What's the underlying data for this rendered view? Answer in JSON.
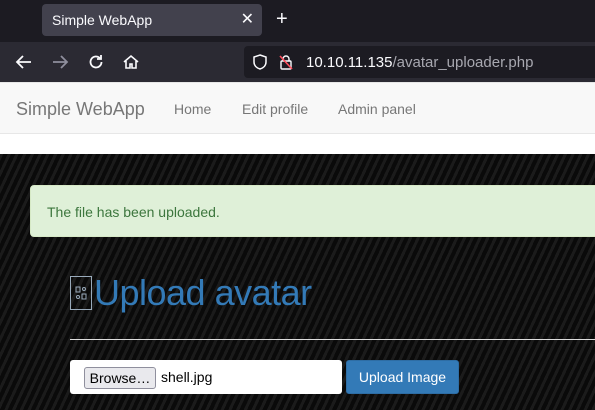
{
  "browser": {
    "tab_title": "Simple WebApp",
    "tab_close": "✕",
    "new_tab": "+",
    "url_host": "10.10.11.135",
    "url_path": "/avatar_uploader.php"
  },
  "site": {
    "brand": "Simple WebApp",
    "nav": [
      "Home",
      "Edit profile",
      "Admin panel"
    ]
  },
  "alert": {
    "message": "The file has been uploaded."
  },
  "upload": {
    "heading": "Upload avatar",
    "browse_label": "Browse…",
    "file_name": "shell.jpg",
    "submit_label": "Upload Image"
  },
  "colors": {
    "link_blue": "#337ab7",
    "alert_green_bg": "#dff0d8",
    "alert_green_text": "#3c763d",
    "browser_dark": "#1c1b22"
  }
}
